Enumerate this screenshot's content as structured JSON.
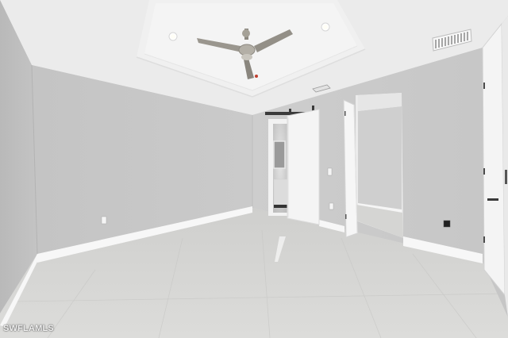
{
  "photo": {
    "watermark": "SWFLAMLS"
  },
  "palette": {
    "wall": "#c9c9c9",
    "ceiling": "#ededed",
    "floor": "#d6d6d4",
    "baseboard": "#f7f7f7",
    "door": "#f3f3f3",
    "fan_metal": "#8c8880"
  },
  "icons": [
    "ceiling-fan-icon",
    "recessed-light-icon",
    "hvac-vent-icon",
    "door-hinge-icon"
  ]
}
